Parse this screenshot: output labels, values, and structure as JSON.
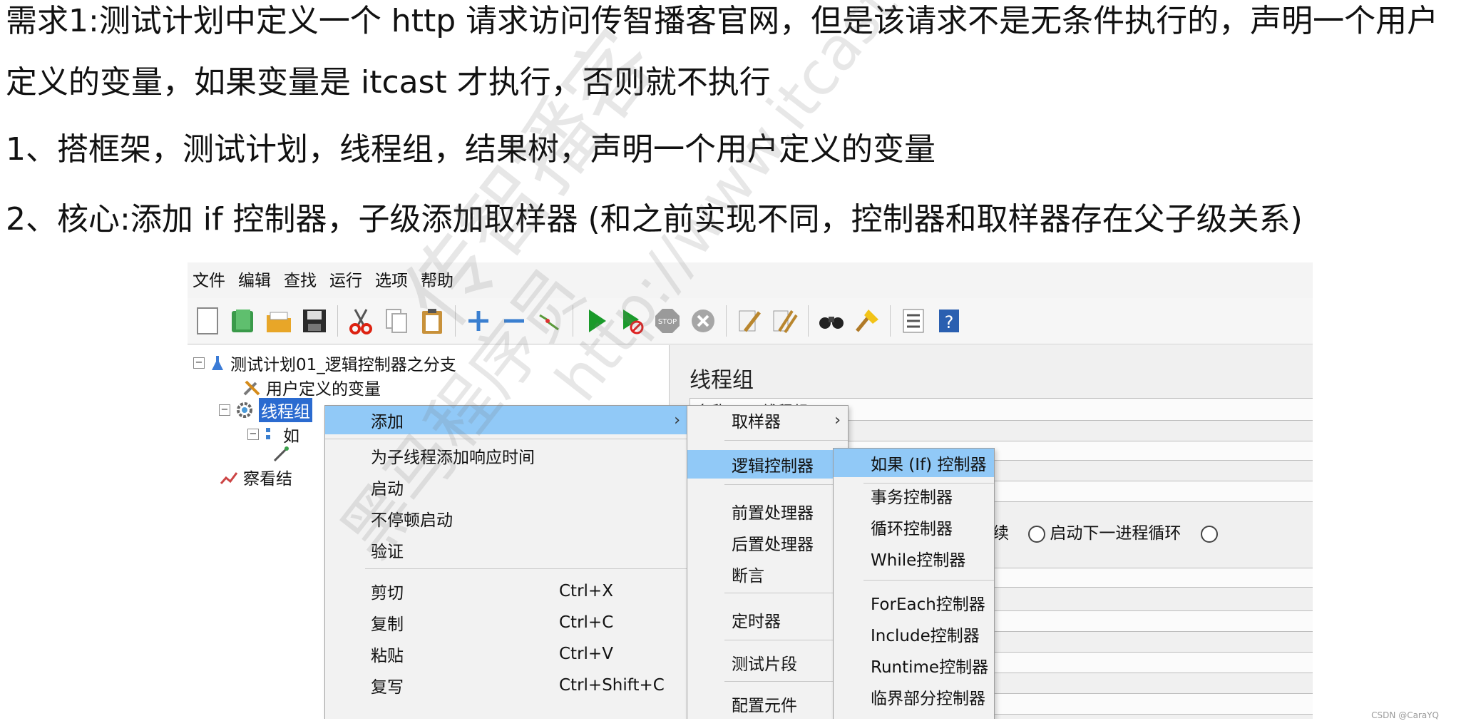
{
  "requirement": {
    "line1": "需求1:测试计划中定义一个 http 请求访问传智播客官网，但是该请求不是无条件执行的，声明一个用户",
    "line2": "定义的变量，如果变量是 itcast 才执行，否则就不执行",
    "step1": "1、搭框架，测试计划，线程组，结果树，声明一个用户定义的变量",
    "step2": "2、核心:添加 if 控制器，子级添加取样器 (和之前实现不同，控制器和取样器存在父子级关系)"
  },
  "menubar": [
    "文件",
    "编辑",
    "查找",
    "运行",
    "选项",
    "帮助"
  ],
  "toolbar_icons": [
    "new-icon",
    "templates-icon",
    "open-icon",
    "save-icon",
    "cut-icon",
    "copy-icon",
    "paste-icon",
    "expand-icon",
    "collapse-icon",
    "toggle-icon",
    "start-icon",
    "start-no-pause-icon",
    "stop-icon",
    "shutdown-icon",
    "clear-icon",
    "clear-all-icon",
    "search-icon",
    "reset-search-icon",
    "function-helper-icon",
    "help-icon"
  ],
  "tree": {
    "plan": "测试计划01_逻辑控制器之分支",
    "user_vars": "用户定义的变量",
    "thread_group": "线程组",
    "if_child": "如",
    "viewer": "察看结"
  },
  "right_panel": {
    "title": "线程组",
    "field_label": "名称:",
    "field_value": "线程组",
    "radio_continue": "继续",
    "radio_next_loop": "启动下一进程循环"
  },
  "context_menu": {
    "add": "添加",
    "add_think_time": "为子线程添加响应时间",
    "start": "启动",
    "start_no_pause": "不停顿启动",
    "validate": "验证",
    "cut": "剪切",
    "cut_sc": "Ctrl+X",
    "copy": "复制",
    "copy_sc": "Ctrl+C",
    "paste": "粘贴",
    "paste_sc": "Ctrl+V",
    "duplicate": "复写",
    "duplicate_sc": "Ctrl+Shift+C"
  },
  "add_submenu": {
    "sampler": "取样器",
    "logic_controller": "逻辑控制器",
    "pre_processor": "前置处理器",
    "post_processor": "后置处理器",
    "assertion": "断言",
    "timer": "定时器",
    "test_fragment": "测试片段",
    "config_element": "配置元件"
  },
  "logic_submenu": {
    "if_controller": "如果 (If) 控制器",
    "transaction_controller": "事务控制器",
    "loop_controller": "循环控制器",
    "while_controller": "While控制器",
    "foreach_controller": "ForEach控制器",
    "include_controller": "Include控制器",
    "runtime_controller": "Runtime控制器",
    "critical_section_controller": "临界部分控制器"
  },
  "watermarks": [
    "传智播客",
    "黑马程序员",
    "http://www.itcast.cn"
  ],
  "credit": "CSDN @CaraYQ",
  "colors": {
    "highlight": "#91c9f7",
    "selection": "#2b6bd0"
  }
}
